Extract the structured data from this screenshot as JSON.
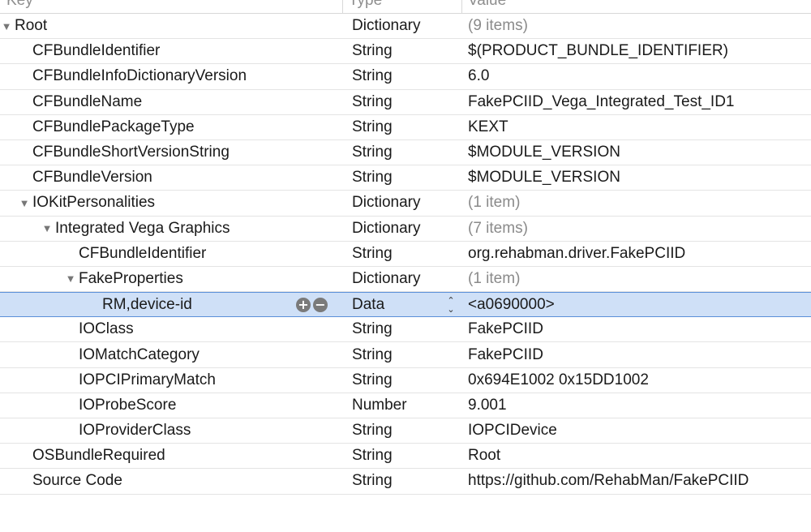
{
  "columns": {
    "key": "Key",
    "type": "Type",
    "value": "Value"
  },
  "icons": {
    "expanded": "disclosure-triangle-down-icon",
    "add": "add-item-icon",
    "remove": "remove-item-icon",
    "stepper": "type-stepper-icon"
  },
  "rows": [
    {
      "key": "Root",
      "type": "Dictionary",
      "value": "(9 items)"
    },
    {
      "key": "CFBundleIdentifier",
      "type": "String",
      "value": "$(PRODUCT_BUNDLE_IDENTIFIER)"
    },
    {
      "key": "CFBundleInfoDictionaryVersion",
      "type": "String",
      "value": "6.0"
    },
    {
      "key": "CFBundleName",
      "type": "String",
      "value": "FakePCIID_Vega_Integrated_Test_ID1"
    },
    {
      "key": "CFBundlePackageType",
      "type": "String",
      "value": "KEXT"
    },
    {
      "key": "CFBundleShortVersionString",
      "type": "String",
      "value": "$MODULE_VERSION"
    },
    {
      "key": "CFBundleVersion",
      "type": "String",
      "value": "$MODULE_VERSION"
    },
    {
      "key": "IOKitPersonalities",
      "type": "Dictionary",
      "value": "(1 item)"
    },
    {
      "key": "Integrated Vega Graphics",
      "type": "Dictionary",
      "value": "(7 items)"
    },
    {
      "key": "CFBundleIdentifier",
      "type": "String",
      "value": "org.rehabman.driver.FakePCIID"
    },
    {
      "key": "FakeProperties",
      "type": "Dictionary",
      "value": "(1 item)"
    },
    {
      "key": "RM,device-id",
      "type": "Data",
      "value": "<a0690000>"
    },
    {
      "key": "IOClass",
      "type": "String",
      "value": "FakePCIID"
    },
    {
      "key": "IOMatchCategory",
      "type": "String",
      "value": "FakePCIID"
    },
    {
      "key": "IOPCIPrimaryMatch",
      "type": "String",
      "value": "0x694E1002 0x15DD1002"
    },
    {
      "key": "IOProbeScore",
      "type": "Number",
      "value": "9.001"
    },
    {
      "key": "IOProviderClass",
      "type": "String",
      "value": "IOPCIDevice"
    },
    {
      "key": "OSBundleRequired",
      "type": "String",
      "value": "Root"
    },
    {
      "key": "Source Code",
      "type": "String",
      "value": "https://github.com/RehabMan/FakePCIID"
    }
  ]
}
